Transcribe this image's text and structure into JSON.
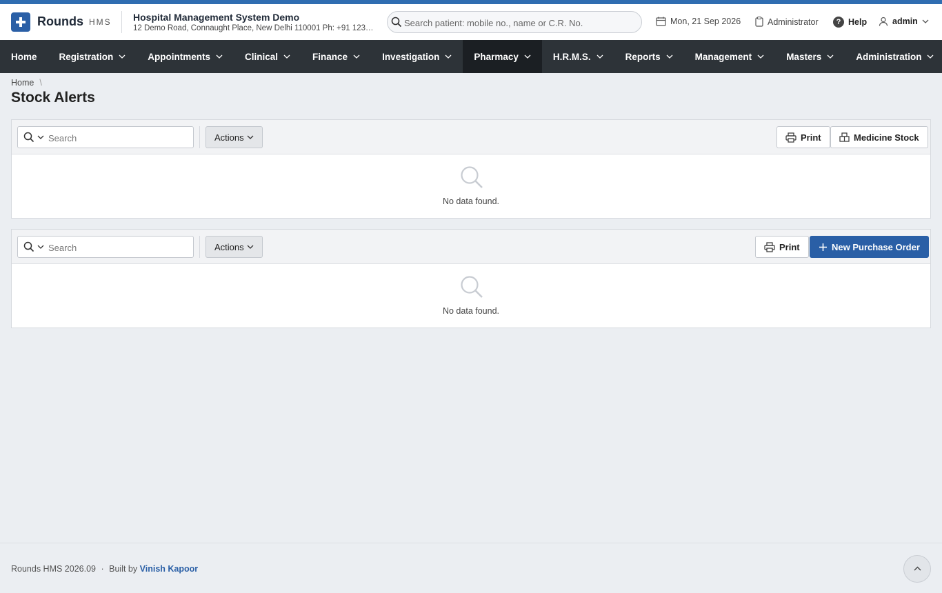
{
  "brand": {
    "name": "Rounds",
    "tag": "HMS",
    "logo_icon": "plus-icon",
    "color": "#2a5fa6"
  },
  "org": {
    "name": "Hospital Management System Demo",
    "address": "12 Demo Road, Connaught Place, New Delhi 110001 Ph: +91 123…"
  },
  "global_search": {
    "placeholder": "Search patient: mobile no., name or C.R. No."
  },
  "header": {
    "date": "Mon, 21 Sep 2026",
    "role": "Administrator",
    "help": "Help",
    "user": "admin"
  },
  "nav": {
    "items": [
      {
        "label": "Home"
      },
      {
        "label": "Registration"
      },
      {
        "label": "Appointments"
      },
      {
        "label": "Clinical"
      },
      {
        "label": "Finance"
      },
      {
        "label": "Investigation"
      },
      {
        "label": "Pharmacy",
        "active": true
      },
      {
        "label": "H.R.M.S."
      },
      {
        "label": "Reports"
      },
      {
        "label": "Management"
      },
      {
        "label": "Masters"
      },
      {
        "label": "Administration"
      }
    ]
  },
  "breadcrumb": {
    "home": "Home",
    "separator": "\\"
  },
  "page": {
    "title": "Stock Alerts"
  },
  "panels": [
    {
      "search_placeholder": "Search",
      "actions_label": "Actions",
      "print_label": "Print",
      "secondary_label": "Medicine Stock",
      "empty_message": "No data found."
    },
    {
      "search_placeholder": "Search",
      "actions_label": "Actions",
      "print_label": "Print",
      "primary_label": "New Purchase Order",
      "empty_message": "No data found."
    }
  ],
  "footer": {
    "version": "Rounds HMS 2026.09",
    "separator": "·",
    "built_by": "Built by",
    "author": "Vinish Kapoor"
  }
}
